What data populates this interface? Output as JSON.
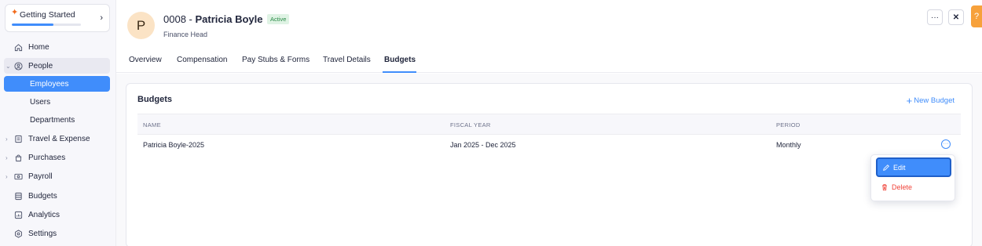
{
  "sidebar": {
    "getting_started": {
      "label": "Getting Started",
      "progress": 0.6
    },
    "items": [
      {
        "label": "Home",
        "icon": "home-icon"
      },
      {
        "label": "People",
        "icon": "people-icon",
        "expanded": true
      },
      {
        "label": "Travel & Expense",
        "icon": "travel-expense-icon"
      },
      {
        "label": "Purchases",
        "icon": "purchases-icon"
      },
      {
        "label": "Payroll",
        "icon": "payroll-icon"
      },
      {
        "label": "Budgets",
        "icon": "budgets-icon"
      },
      {
        "label": "Analytics",
        "icon": "analytics-icon"
      },
      {
        "label": "Settings",
        "icon": "settings-icon"
      }
    ],
    "people_sub": [
      {
        "label": "Employees",
        "active": true
      },
      {
        "label": "Users"
      },
      {
        "label": "Departments"
      }
    ]
  },
  "header": {
    "avatar_initial": "P",
    "employee_id": "0008 - ",
    "employee_name": "Patricia Boyle",
    "status": "Active",
    "role": "Finance Head",
    "more_button": "···",
    "close_button": "✕",
    "help_label": "?"
  },
  "tabs": [
    {
      "label": "Overview"
    },
    {
      "label": "Compensation"
    },
    {
      "label": "Pay Stubs & Forms"
    },
    {
      "label": "Travel Details"
    },
    {
      "label": "Budgets",
      "active": true
    }
  ],
  "budgets": {
    "title": "Budgets",
    "new_button": "New Budget",
    "columns": [
      "NAME",
      "FISCAL YEAR",
      "PERIOD"
    ],
    "rows": [
      {
        "name": "Patricia Boyle-2025",
        "fiscal_year": "Jan 2025 - Dec 2025",
        "period": "Monthly"
      }
    ]
  },
  "row_menu": {
    "edit_label": "Edit",
    "delete_label": "Delete"
  },
  "colors": {
    "accent": "#408dfb",
    "danger": "#f0443a",
    "active_badge_bg": "#dff3e4",
    "active_badge_text": "#2a8a47"
  }
}
